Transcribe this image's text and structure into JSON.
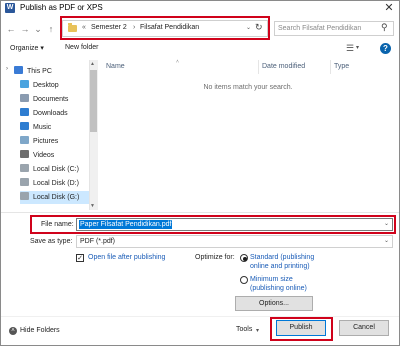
{
  "window": {
    "title": "Publish as PDF or XPS",
    "app_icon_letter": "W",
    "close_glyph": "✕"
  },
  "nav": {
    "back_glyph": "←",
    "forward_glyph": "→",
    "up_glyph": "↑",
    "recent_glyph": "⌄"
  },
  "address": {
    "prefix": "«",
    "segments": [
      "Semester 2",
      "Filsafat Pendidikan"
    ],
    "separator": "›",
    "dropdown_glyph": "⌄",
    "refresh_glyph": "↻"
  },
  "search": {
    "placeholder": "Search Filsafat Pendidikan",
    "icon_glyph": "⚲"
  },
  "toolbar": {
    "organize_label": "Organize ▾",
    "new_folder_label": "New folder",
    "view_glyph": "☰",
    "view_dropdown_glyph": "▾",
    "help_glyph": "?"
  },
  "sidebar": {
    "items": [
      {
        "label": "This PC",
        "icon_color": "#3a7bd5"
      },
      {
        "label": "Desktop",
        "icon_color": "#4aa3df"
      },
      {
        "label": "Documents",
        "icon_color": "#8a9bb0"
      },
      {
        "label": "Downloads",
        "icon_color": "#2e7dd1"
      },
      {
        "label": "Music",
        "icon_color": "#2e7dd1"
      },
      {
        "label": "Pictures",
        "icon_color": "#7fa7c9"
      },
      {
        "label": "Videos",
        "icon_color": "#6d6d6d"
      },
      {
        "label": "Local Disk (C:)",
        "icon_color": "#9aa4ad"
      },
      {
        "label": "Local Disk (D:)",
        "icon_color": "#9aa4ad"
      },
      {
        "label": "Local Disk (G:)",
        "icon_color": "#9aa4ad"
      }
    ],
    "selected_index": 9,
    "tree_caret": "›"
  },
  "filelist": {
    "columns": [
      "Name",
      "Date modified",
      "Type"
    ],
    "sort_glyph": "˄",
    "empty_message": "No items match your search."
  },
  "form": {
    "file_name_label": "File name:",
    "file_name_value": "Paper Filsafat Pendidikan.pdf",
    "save_type_label": "Save as type:",
    "save_type_value": "PDF (*.pdf)",
    "dropdown_glyph": "⌄",
    "open_after_label": "Open file after publishing",
    "open_after_checked": "✓",
    "optimize_label": "Optimize for:",
    "radio_standard": [
      "Standard (publishing",
      "online and printing)"
    ],
    "radio_minimum": [
      "Minimum size",
      "(publishing online)"
    ],
    "options_label": "Options..."
  },
  "footer": {
    "hide_folders_label": "Hide Folders",
    "hide_glyph": "˄",
    "tools_label": "Tools",
    "tools_dd_glyph": "▾",
    "publish_label": "Publish",
    "cancel_label": "Cancel"
  },
  "colors": {
    "highlight": "#d0021b",
    "selection": "#0078d7",
    "link": "#1a5cb7"
  }
}
